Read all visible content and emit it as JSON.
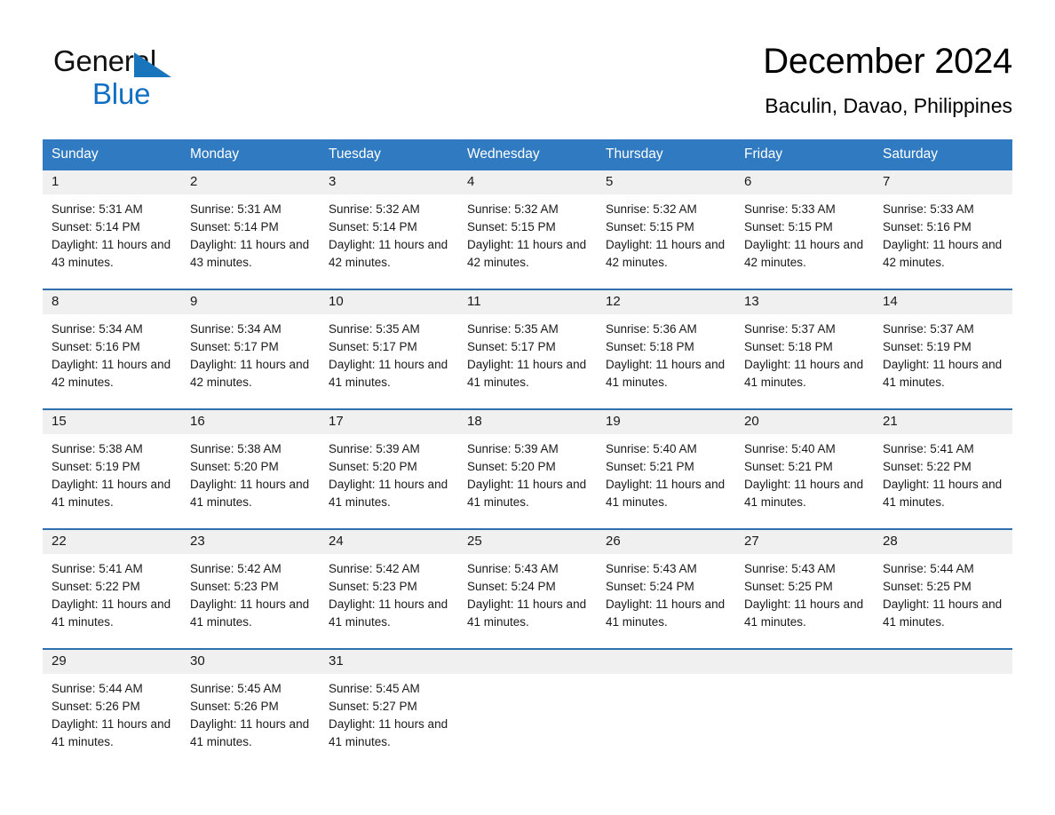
{
  "brand": {
    "name_part1": "General",
    "name_part2": "Blue",
    "triangle_icon": "logo-triangle",
    "accent_color": "#1170c4"
  },
  "header": {
    "title": "December 2024",
    "subtitle": "Baculin, Davao, Philippines"
  },
  "theme": {
    "header_blue": "#2f7ac0",
    "row_rule_blue": "#2f6fae",
    "daynum_band": "#f0f0f0"
  },
  "weekday_headers": [
    "Sunday",
    "Monday",
    "Tuesday",
    "Wednesday",
    "Thursday",
    "Friday",
    "Saturday"
  ],
  "weeks": [
    [
      {
        "day": "1",
        "sunrise": "Sunrise: 5:31 AM",
        "sunset": "Sunset: 5:14 PM",
        "daylight": "Daylight: 11 hours and 43 minutes."
      },
      {
        "day": "2",
        "sunrise": "Sunrise: 5:31 AM",
        "sunset": "Sunset: 5:14 PM",
        "daylight": "Daylight: 11 hours and 43 minutes."
      },
      {
        "day": "3",
        "sunrise": "Sunrise: 5:32 AM",
        "sunset": "Sunset: 5:14 PM",
        "daylight": "Daylight: 11 hours and 42 minutes."
      },
      {
        "day": "4",
        "sunrise": "Sunrise: 5:32 AM",
        "sunset": "Sunset: 5:15 PM",
        "daylight": "Daylight: 11 hours and 42 minutes."
      },
      {
        "day": "5",
        "sunrise": "Sunrise: 5:32 AM",
        "sunset": "Sunset: 5:15 PM",
        "daylight": "Daylight: 11 hours and 42 minutes."
      },
      {
        "day": "6",
        "sunrise": "Sunrise: 5:33 AM",
        "sunset": "Sunset: 5:15 PM",
        "daylight": "Daylight: 11 hours and 42 minutes."
      },
      {
        "day": "7",
        "sunrise": "Sunrise: 5:33 AM",
        "sunset": "Sunset: 5:16 PM",
        "daylight": "Daylight: 11 hours and 42 minutes."
      }
    ],
    [
      {
        "day": "8",
        "sunrise": "Sunrise: 5:34 AM",
        "sunset": "Sunset: 5:16 PM",
        "daylight": "Daylight: 11 hours and 42 minutes."
      },
      {
        "day": "9",
        "sunrise": "Sunrise: 5:34 AM",
        "sunset": "Sunset: 5:17 PM",
        "daylight": "Daylight: 11 hours and 42 minutes."
      },
      {
        "day": "10",
        "sunrise": "Sunrise: 5:35 AM",
        "sunset": "Sunset: 5:17 PM",
        "daylight": "Daylight: 11 hours and 41 minutes."
      },
      {
        "day": "11",
        "sunrise": "Sunrise: 5:35 AM",
        "sunset": "Sunset: 5:17 PM",
        "daylight": "Daylight: 11 hours and 41 minutes."
      },
      {
        "day": "12",
        "sunrise": "Sunrise: 5:36 AM",
        "sunset": "Sunset: 5:18 PM",
        "daylight": "Daylight: 11 hours and 41 minutes."
      },
      {
        "day": "13",
        "sunrise": "Sunrise: 5:37 AM",
        "sunset": "Sunset: 5:18 PM",
        "daylight": "Daylight: 11 hours and 41 minutes."
      },
      {
        "day": "14",
        "sunrise": "Sunrise: 5:37 AM",
        "sunset": "Sunset: 5:19 PM",
        "daylight": "Daylight: 11 hours and 41 minutes."
      }
    ],
    [
      {
        "day": "15",
        "sunrise": "Sunrise: 5:38 AM",
        "sunset": "Sunset: 5:19 PM",
        "daylight": "Daylight: 11 hours and 41 minutes."
      },
      {
        "day": "16",
        "sunrise": "Sunrise: 5:38 AM",
        "sunset": "Sunset: 5:20 PM",
        "daylight": "Daylight: 11 hours and 41 minutes."
      },
      {
        "day": "17",
        "sunrise": "Sunrise: 5:39 AM",
        "sunset": "Sunset: 5:20 PM",
        "daylight": "Daylight: 11 hours and 41 minutes."
      },
      {
        "day": "18",
        "sunrise": "Sunrise: 5:39 AM",
        "sunset": "Sunset: 5:20 PM",
        "daylight": "Daylight: 11 hours and 41 minutes."
      },
      {
        "day": "19",
        "sunrise": "Sunrise: 5:40 AM",
        "sunset": "Sunset: 5:21 PM",
        "daylight": "Daylight: 11 hours and 41 minutes."
      },
      {
        "day": "20",
        "sunrise": "Sunrise: 5:40 AM",
        "sunset": "Sunset: 5:21 PM",
        "daylight": "Daylight: 11 hours and 41 minutes."
      },
      {
        "day": "21",
        "sunrise": "Sunrise: 5:41 AM",
        "sunset": "Sunset: 5:22 PM",
        "daylight": "Daylight: 11 hours and 41 minutes."
      }
    ],
    [
      {
        "day": "22",
        "sunrise": "Sunrise: 5:41 AM",
        "sunset": "Sunset: 5:22 PM",
        "daylight": "Daylight: 11 hours and 41 minutes."
      },
      {
        "day": "23",
        "sunrise": "Sunrise: 5:42 AM",
        "sunset": "Sunset: 5:23 PM",
        "daylight": "Daylight: 11 hours and 41 minutes."
      },
      {
        "day": "24",
        "sunrise": "Sunrise: 5:42 AM",
        "sunset": "Sunset: 5:23 PM",
        "daylight": "Daylight: 11 hours and 41 minutes."
      },
      {
        "day": "25",
        "sunrise": "Sunrise: 5:43 AM",
        "sunset": "Sunset: 5:24 PM",
        "daylight": "Daylight: 11 hours and 41 minutes."
      },
      {
        "day": "26",
        "sunrise": "Sunrise: 5:43 AM",
        "sunset": "Sunset: 5:24 PM",
        "daylight": "Daylight: 11 hours and 41 minutes."
      },
      {
        "day": "27",
        "sunrise": "Sunrise: 5:43 AM",
        "sunset": "Sunset: 5:25 PM",
        "daylight": "Daylight: 11 hours and 41 minutes."
      },
      {
        "day": "28",
        "sunrise": "Sunrise: 5:44 AM",
        "sunset": "Sunset: 5:25 PM",
        "daylight": "Daylight: 11 hours and 41 minutes."
      }
    ],
    [
      {
        "day": "29",
        "sunrise": "Sunrise: 5:44 AM",
        "sunset": "Sunset: 5:26 PM",
        "daylight": "Daylight: 11 hours and 41 minutes."
      },
      {
        "day": "30",
        "sunrise": "Sunrise: 5:45 AM",
        "sunset": "Sunset: 5:26 PM",
        "daylight": "Daylight: 11 hours and 41 minutes."
      },
      {
        "day": "31",
        "sunrise": "Sunrise: 5:45 AM",
        "sunset": "Sunset: 5:27 PM",
        "daylight": "Daylight: 11 hours and 41 minutes."
      },
      {
        "day": "",
        "sunrise": "",
        "sunset": "",
        "daylight": ""
      },
      {
        "day": "",
        "sunrise": "",
        "sunset": "",
        "daylight": ""
      },
      {
        "day": "",
        "sunrise": "",
        "sunset": "",
        "daylight": ""
      },
      {
        "day": "",
        "sunrise": "",
        "sunset": "",
        "daylight": ""
      }
    ]
  ]
}
